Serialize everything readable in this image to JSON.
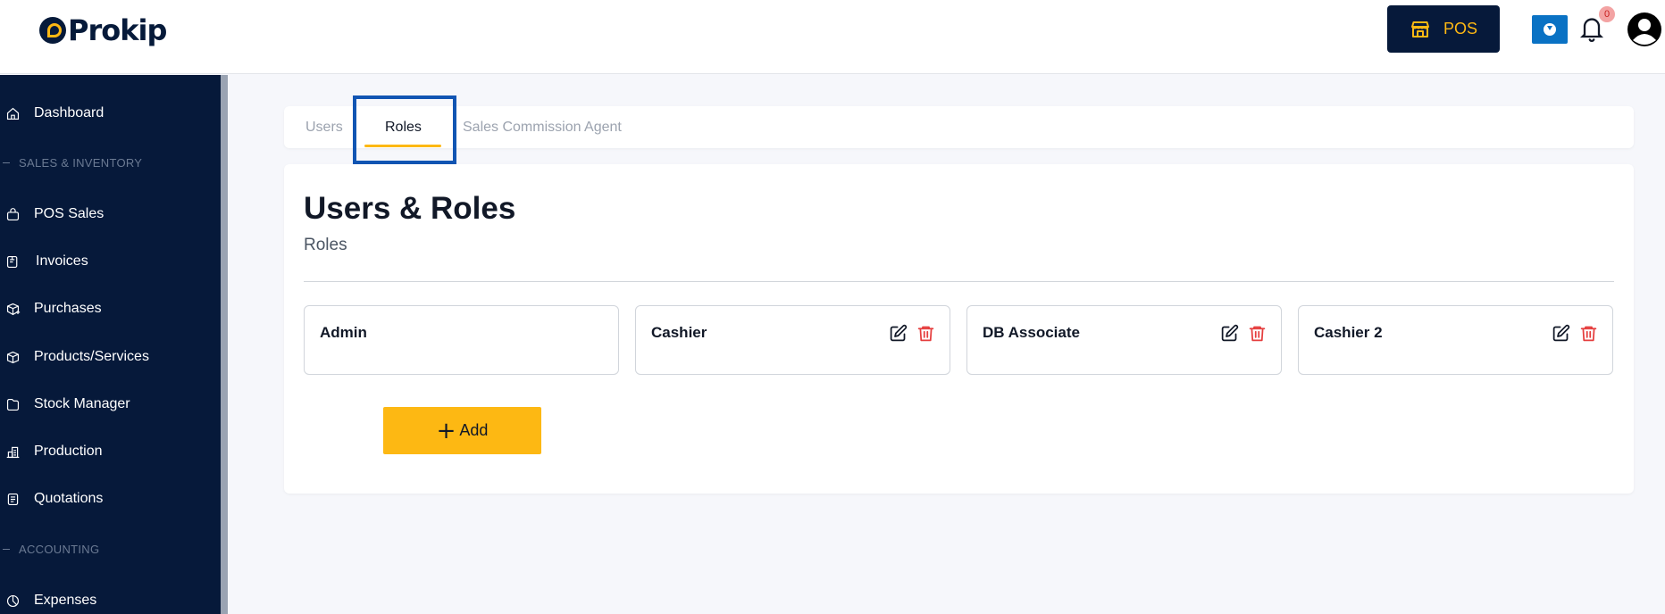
{
  "header": {
    "brand": "Prokip",
    "pos_label": "POS",
    "notification_count": "0"
  },
  "sidebar": {
    "items": [
      {
        "label": "Dashboard",
        "icon": "home-icon"
      },
      {
        "section": "SALES & INVENTORY"
      },
      {
        "label": "POS Sales",
        "icon": "shopping-bag-icon"
      },
      {
        "label": "Invoices",
        "icon": "invoice-icon"
      },
      {
        "label": "Purchases",
        "icon": "package-plus-icon"
      },
      {
        "label": "Products/Services",
        "icon": "box-icon"
      },
      {
        "label": "Stock Manager",
        "icon": "folder-icon"
      },
      {
        "label": "Production",
        "icon": "factory-icon"
      },
      {
        "label": "Quotations",
        "icon": "document-icon"
      },
      {
        "section": "ACCOUNTING"
      },
      {
        "label": "Expenses",
        "icon": "pie-chart-icon"
      }
    ]
  },
  "tabs": [
    {
      "label": "Users",
      "active": false
    },
    {
      "label": "Roles",
      "active": true
    },
    {
      "label": "Sales Commission Agent",
      "active": false
    }
  ],
  "main": {
    "title": "Users & Roles",
    "subtitle": "Roles",
    "roles": [
      {
        "name": "Admin",
        "editable": false
      },
      {
        "name": "Cashier",
        "editable": true
      },
      {
        "name": "DB Associate",
        "editable": true
      },
      {
        "name": "Cashier 2",
        "editable": true
      }
    ],
    "add_label": "Add"
  },
  "colors": {
    "sidebar_bg": "#06193a",
    "accent": "#fdb813",
    "delete": "#e53e3e",
    "highlight": "#1155b3"
  }
}
